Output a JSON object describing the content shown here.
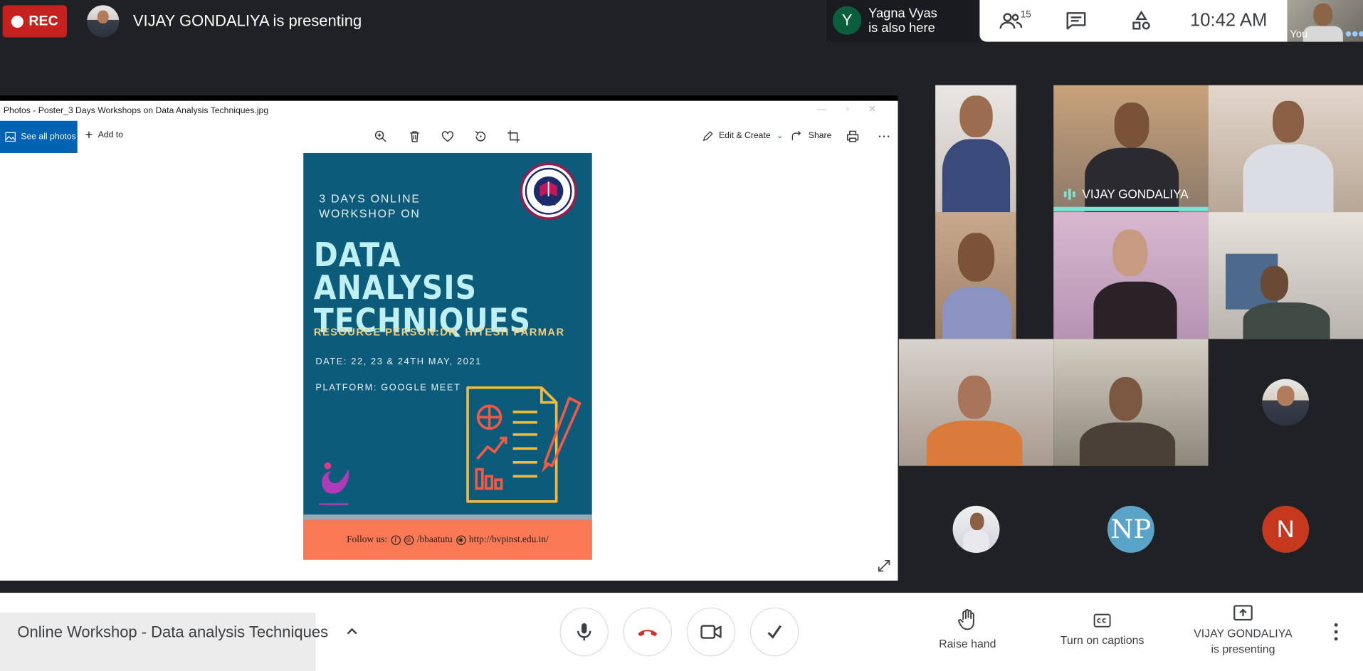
{
  "top": {
    "rec_label": "REC",
    "presenting_text": "VIJAY GONDALIYA is presenting",
    "also_here_initial": "Y",
    "also_here_name": "Yagna Vyas",
    "also_here_suffix": "is also here",
    "people_count": "15",
    "time": "10:42  AM",
    "self_label": "You"
  },
  "photos": {
    "window_title": "Photos - Poster_3 Days Workshops on Data Analysis Techniques.jpg",
    "see_all": "See all photos",
    "add_to": "Add to",
    "edit_create": "Edit & Create",
    "share": "Share"
  },
  "poster": {
    "line1": "3 DAYS ONLINE",
    "line2": "WORKSHOP ON",
    "title1": "DATA ANALYSIS",
    "title2": "TECHNIQUES",
    "resource": "RESOURCE PERSON:DR. HITESH PARMAR",
    "date": "DATE: 22, 23 & 24TH MAY, 2021",
    "platform": "PLATFORM: GOOGLE MEET",
    "follow": "Follow us:",
    "handle": "/bbaatutu",
    "site": "http://bvpinst.edu.in/"
  },
  "participants": {
    "speaker_name": "VIJAY GONDALIYA"
  },
  "bottom": {
    "meeting_title": "Online Workshop - Data analysis Techniques",
    "raise_hand": "Raise hand",
    "captions": "Turn on captions",
    "presenting_line1": "VIJAY GONDALIYA",
    "presenting_line2": "is presenting"
  },
  "colors": {
    "rec_red": "#c5221f",
    "speaker_accent": "#7de3d6",
    "end_call_red": "#d93025",
    "photos_blue": "#0063b1",
    "poster_teal": "#0c5b7a",
    "poster_footer": "#fa7955"
  }
}
